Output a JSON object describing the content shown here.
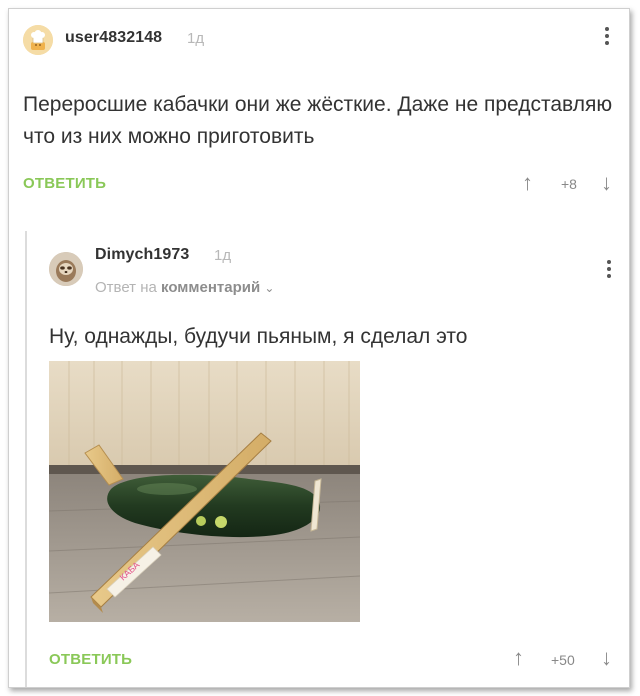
{
  "comment1": {
    "username": "user4832148",
    "time": "1д",
    "text": "Переросшие кабачки они же жёсткие. Даже не представляю что из них можно приготовить",
    "reply_label": "ОТВЕТИТЬ",
    "rating": "+8"
  },
  "comment2": {
    "username": "Dimych1973",
    "time": "1д",
    "reply_prefix": "Ответ на",
    "reply_target": "комментарий",
    "text": "Ну, однажды, будучи пьяным, я сделал это",
    "reply_label": "ОТВЕТИТЬ",
    "rating": "+50",
    "photo_label": "КАБА"
  },
  "colors": {
    "accent": "#8ac858",
    "text": "#333333",
    "muted": "#b4b4b4"
  },
  "icons": [
    "avatar-chef-icon",
    "avatar-sloth-icon",
    "more-vertical-icon",
    "arrow-up-icon",
    "arrow-down-icon",
    "chevron-down-icon"
  ]
}
